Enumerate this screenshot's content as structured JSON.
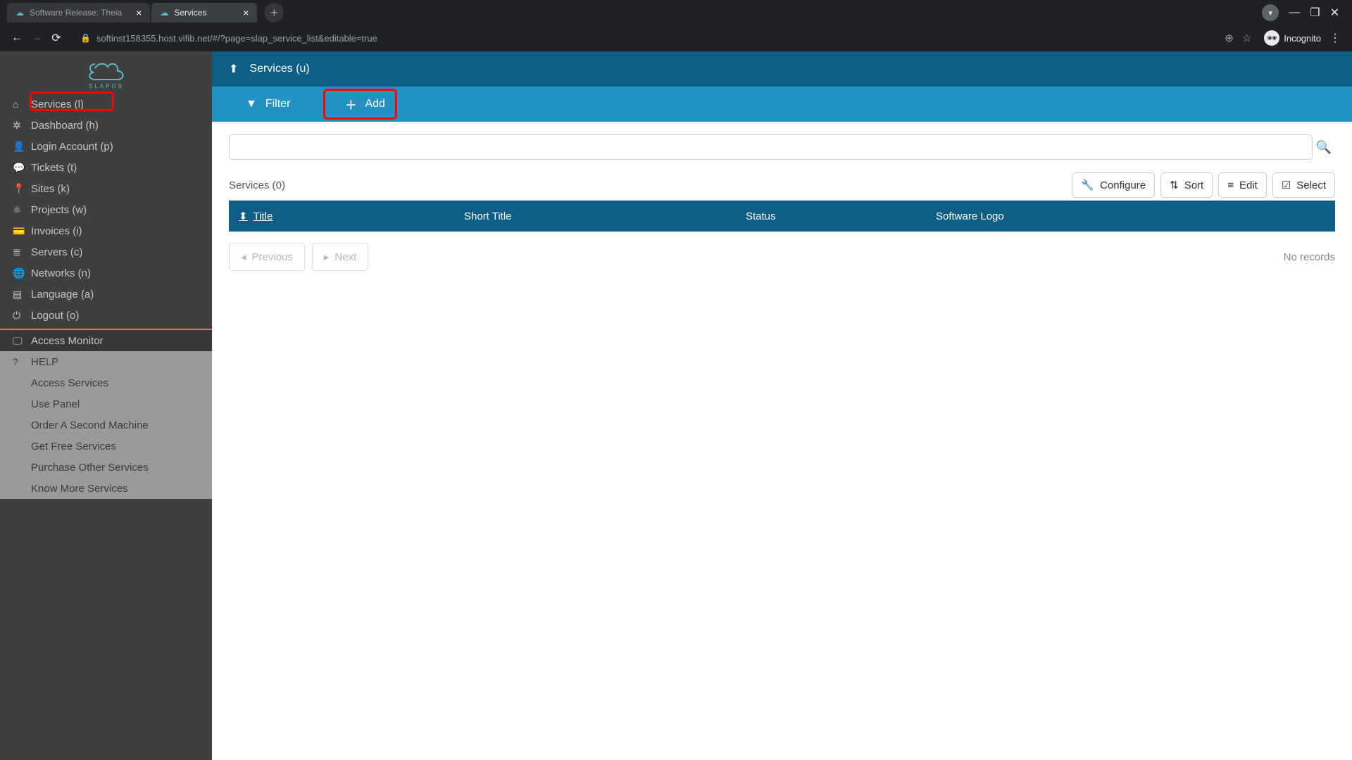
{
  "browser": {
    "tabs": [
      {
        "title": "Software Release: Theia"
      },
      {
        "title": "Services"
      }
    ],
    "url": "softinst158355.host.vifib.net/#/?page=slap_service_list&editable=true",
    "incognito_label": "Incognito"
  },
  "sidebar": {
    "logo": "SLAPOS",
    "items": [
      {
        "icon": "home-icon",
        "glyph": "⌂",
        "label": "Services (l)"
      },
      {
        "icon": "dashboard-icon",
        "glyph": "✲",
        "label": "Dashboard (h)"
      },
      {
        "icon": "user-icon",
        "glyph": "👤",
        "label": "Login Account (p)"
      },
      {
        "icon": "chat-icon",
        "glyph": "💬",
        "label": "Tickets (t)"
      },
      {
        "icon": "pin-icon",
        "glyph": "📍",
        "label": "Sites (k)"
      },
      {
        "icon": "share-icon",
        "glyph": "⚛",
        "label": "Projects (w)"
      },
      {
        "icon": "card-icon",
        "glyph": "💳",
        "label": "Invoices (i)"
      },
      {
        "icon": "db-icon",
        "glyph": "≣",
        "label": "Servers (c)"
      },
      {
        "icon": "globe-icon",
        "glyph": "🌐",
        "label": "Networks (n)"
      },
      {
        "icon": "lang-icon",
        "glyph": "▤",
        "label": "Language (a)"
      },
      {
        "icon": "power-icon",
        "glyph": "⏻",
        "label": "Logout (o)"
      }
    ],
    "monitor": {
      "icon": "monitor-icon",
      "glyph": "🖵",
      "label": "Access Monitor"
    },
    "help": {
      "title": "HELP",
      "items": [
        {
          "label": "Access Services"
        },
        {
          "label": "Use Panel"
        },
        {
          "label": "Order A Second Machine"
        },
        {
          "label": "Get Free Services"
        },
        {
          "label": "Purchase Other Services"
        },
        {
          "label": "Know More Services"
        }
      ]
    }
  },
  "header": {
    "breadcrumb": "Services (u)"
  },
  "toolbar": {
    "filter_label": "Filter",
    "add_label": "Add"
  },
  "list": {
    "count_label": "Services (0)",
    "actions": {
      "configure": "Configure",
      "sort": "Sort",
      "edit": "Edit",
      "select": "Select"
    },
    "columns": {
      "title": "Title",
      "short_title": "Short Title",
      "status": "Status",
      "software_logo": "Software Logo"
    },
    "prev": "Previous",
    "next": "Next",
    "empty": "No records"
  }
}
